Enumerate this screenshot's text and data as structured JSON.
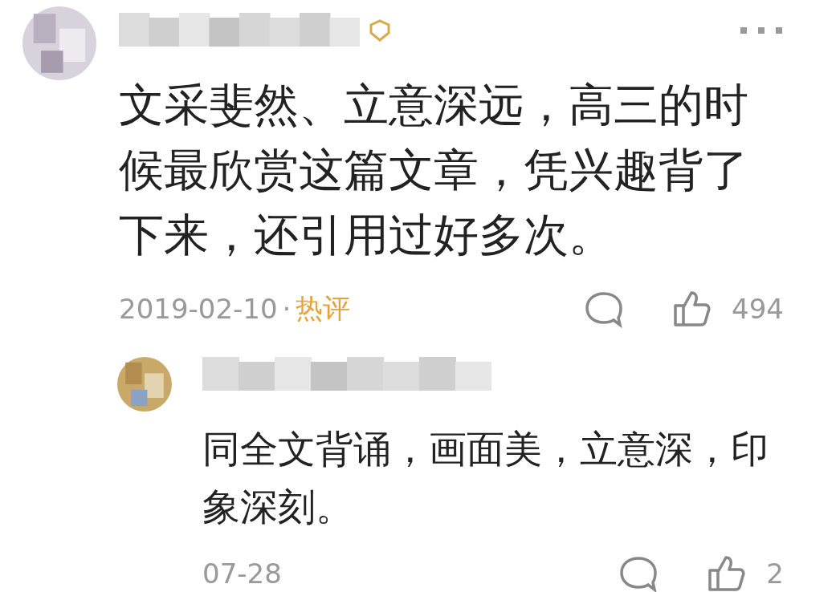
{
  "comments": [
    {
      "text": "文采斐然、立意深远，高三的时候最欣赏这篇文章，凭兴趣背了下来，还引用过好多次。",
      "date": "2019-02-10",
      "separator": "·",
      "tag": "热评",
      "likes": "494",
      "verified": true,
      "more": true
    },
    {
      "text": "同全文背诵，画面美，立意深，印象深刻。",
      "date": "07-28",
      "likes": "2",
      "verified": false,
      "more": false
    }
  ]
}
